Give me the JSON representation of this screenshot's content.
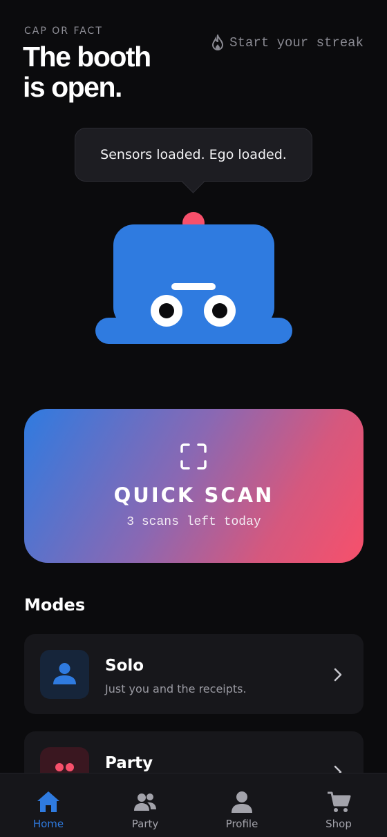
{
  "header": {
    "eyebrow": "CAP OR FACT",
    "title_line1": "The booth",
    "title_line2": "is open.",
    "streak_label": "Start your streak",
    "streak_icon": "flame-icon"
  },
  "mascot": {
    "speech": "Sensors loaded. Ego loaded.",
    "body_color": "#2f7be0",
    "antenna_color": "#f7506b"
  },
  "quick_scan": {
    "title": "QUICK SCAN",
    "subtitle": "3 scans left today",
    "icon": "scan-frame-icon",
    "gradient_from": "#2f7be0",
    "gradient_to": "#f7506b"
  },
  "modes": {
    "section_title": "Modes",
    "items": [
      {
        "name": "Solo",
        "description": "Just you and the receipts.",
        "icon": "person-icon",
        "accent": "#2f7be0"
      },
      {
        "name": "Party",
        "description": "",
        "icon": "group-dots-icon",
        "accent": "#f7506b"
      }
    ]
  },
  "tabbar": {
    "active": "Home",
    "items": [
      {
        "label": "Home",
        "icon": "home-icon"
      },
      {
        "label": "Party",
        "icon": "people-icon"
      },
      {
        "label": "Profile",
        "icon": "profile-icon"
      },
      {
        "label": "Shop",
        "icon": "cart-icon"
      }
    ]
  }
}
